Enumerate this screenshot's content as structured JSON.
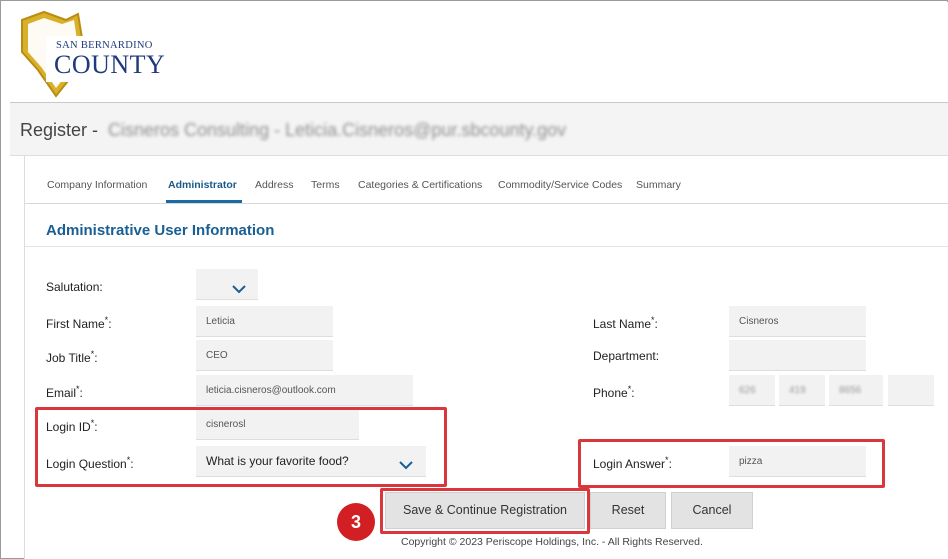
{
  "header": {
    "logo_line1": "SAN BERNARDINO",
    "logo_line2": "COUNTY"
  },
  "page": {
    "title_prefix": "Register -",
    "title_subject": "Cisneros Consulting - Leticia.Cisneros@pur.sbcounty.gov"
  },
  "tabs": [
    {
      "label": "Company Information",
      "active": false
    },
    {
      "label": "Administrator",
      "active": true
    },
    {
      "label": "Address",
      "active": false
    },
    {
      "label": "Terms",
      "active": false
    },
    {
      "label": "Categories & Certifications",
      "active": false
    },
    {
      "label": "Commodity/Service Codes",
      "active": false
    },
    {
      "label": "Summary",
      "active": false
    }
  ],
  "form": {
    "section_title": "Administrative User Information",
    "required_mark": "*",
    "label_suffix": ":",
    "salutation": {
      "label": "Salutation:",
      "value": ""
    },
    "first_name": {
      "label": "First Name",
      "value": "Leticia"
    },
    "last_name": {
      "label": "Last Name",
      "value": "Cisneros"
    },
    "job_title": {
      "label": "Job Title",
      "value": "CEO"
    },
    "department": {
      "label": "Department:",
      "value": ""
    },
    "email": {
      "label": "Email",
      "value": "leticia.cisneros@outlook.com"
    },
    "phone": {
      "label": "Phone",
      "area": "626",
      "prefix": "419",
      "line": "8656",
      "ext": ""
    },
    "login_id": {
      "label": "Login ID",
      "value": "cisnerosl"
    },
    "login_question": {
      "label": "Login Question",
      "value": "What is your favorite food?"
    },
    "login_answer": {
      "label": "Login Answer",
      "value": "pizza"
    }
  },
  "buttons": {
    "save": "Save & Continue Registration",
    "reset": "Reset",
    "cancel": "Cancel"
  },
  "step_badge": "3",
  "footer": {
    "copyright": "Copyright © 2023 Periscope Holdings, Inc. - All Rights Reserved."
  },
  "colors": {
    "accent": "#1a5f93",
    "highlight": "#d9373b",
    "badge": "#d21f23"
  },
  "icons": {
    "logo": "county-shield-icon",
    "dropdown": "chevron-down-icon"
  }
}
